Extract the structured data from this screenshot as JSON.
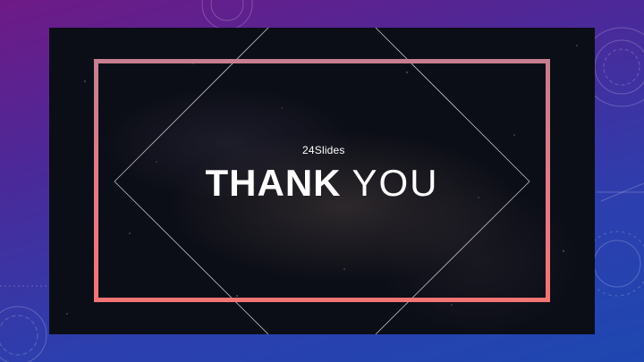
{
  "slide": {
    "logo_text": "24Slides",
    "title_bold": "THANK",
    "title_light": "YOU"
  },
  "colors": {
    "bg_top": "#6e1a86",
    "bg_bottom": "#1e47b0",
    "panel": "#0c0e17",
    "frame_top": "#c67f8e",
    "frame_bottom": "#f37475",
    "text": "#ffffff"
  },
  "icons": {
    "background": "tech-circle-icon"
  }
}
